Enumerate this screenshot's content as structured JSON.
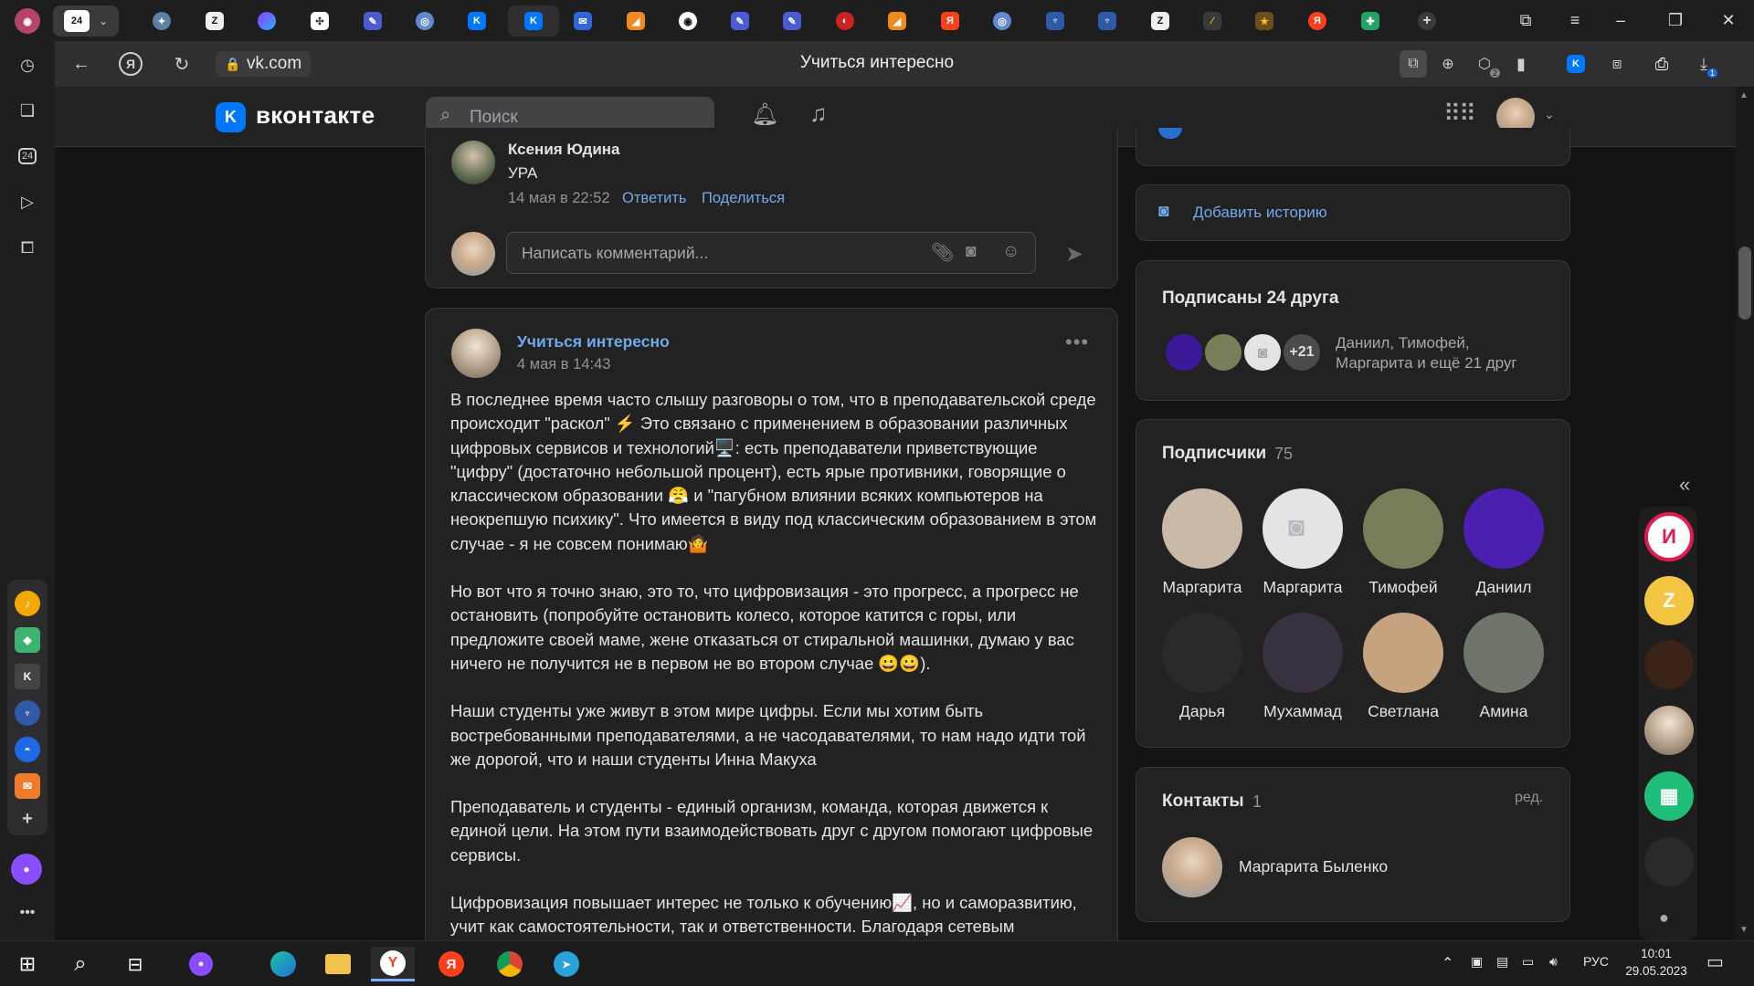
{
  "browser": {
    "tab_count_badge": "24",
    "url": "vk.com",
    "page_title": "Учиться интересно",
    "download_badge": "1",
    "collections_badge": "2"
  },
  "vk": {
    "brand": "вконтакте",
    "search_placeholder": "Поиск"
  },
  "previous_post": {
    "comment_author": "Ксения Юдина",
    "comment_text": "УРА",
    "comment_time": "14 мая в 22:52",
    "reply_label": "Ответить",
    "share_label": "Поделиться",
    "comment_placeholder": "Написать комментарий..."
  },
  "post": {
    "author": "Учиться интересно",
    "time": "4 мая в 14:43",
    "paragraphs": [
      "В последнее время часто слышу разговоры о том, что в преподавательской среде происходит \"раскол\" ⚡ Это связано с применением в образовании различных цифровых сервисов и технологий🖥️: есть преподаватели приветствующие \"цифру\" (достаточно небольшой процент), есть ярые противники, говорящие о классическом образовании 😤 и \"пагубном влиянии всяких компьютеров на неокрепшую психику\". Что имеется в виду под классическим образованием в этом случае - я не совсем понимаю🤷",
      "Но вот что я точно знаю, это то, что цифровизация - это прогресс, а прогресс не остановить (попробуйте остановить колесо, которое катится с горы, или предложите своей маме, жене отказаться от стиральной машинки, думаю у вас ничего не получится не в первом не во втором случае 😀😀).",
      "Наши студенты уже живут в этом мире цифры. Если мы хотим быть востребованными преподавателями, а не часодавателями, то нам надо идти той же дорогой, что и наши студенты Инна Макуха",
      "Преподаватель и студенты - единый организм, команда, которая движется к единой цели. На этом пути взаимодействовать друг с другом помогают цифровые сервисы.",
      "Цифровизация повышает интерес не только к обучению📈, но и саморазвитию, учит как самостоятельности, так и ответственности. Благодаря сетевым"
    ]
  },
  "sidebar": {
    "add_story": "Добавить историю",
    "friends_title": "Подписаны 24 друга",
    "friends_more": "+21",
    "friends_names": "Даниил, Тимофей,",
    "friends_names2": "Маргарита и ещё 21 друг",
    "followers_title": "Подписчики",
    "followers_count": "75",
    "followers": [
      {
        "name": "Маргарита",
        "color": "#c9b9a7"
      },
      {
        "name": "Маргарита",
        "color": "#e3e4e6"
      },
      {
        "name": "Тимофей",
        "color": "#7a7d5a"
      },
      {
        "name": "Даниил",
        "color": "#4b1fb0"
      },
      {
        "name": "Дарья",
        "color": "#2a2a2a"
      },
      {
        "name": "Мухаммад",
        "color": "#3a3140"
      },
      {
        "name": "Светлана",
        "color": "#c7a27f"
      },
      {
        "name": "Амина",
        "color": "#6f756a"
      }
    ],
    "contacts_title": "Контакты",
    "contacts_count": "1",
    "contacts_edit": "ред.",
    "contact_name": "Маргарита Быленко"
  },
  "taskbar": {
    "lang": "РУС",
    "time": "10:01",
    "date": "29.05.2023"
  },
  "colors": {
    "vk_blue": "#0077ff",
    "link": "#71aaeb",
    "card_bg": "#222222",
    "page_bg": "#141414"
  }
}
